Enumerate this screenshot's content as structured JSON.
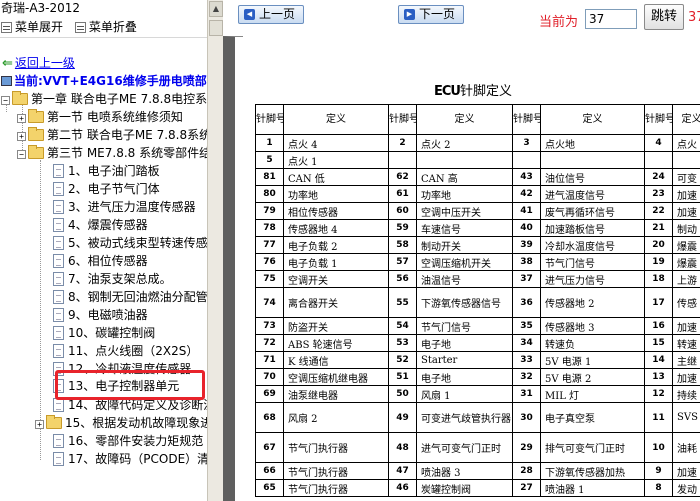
{
  "left": {
    "title": "奇瑞-A3-2012",
    "menu": {
      "expand": "菜单展开",
      "collapse": "菜单折叠"
    },
    "back_link": "返回上一级",
    "current": "当前:VVT+E4G16维修手册电喷部",
    "tree": [
      {
        "kind": "chapter",
        "label": "第一章  联合电子ME 7.8.8电控系",
        "toggle": "−"
      },
      {
        "kind": "section",
        "label": "第一节  电喷系统维修须知",
        "toggle": "+"
      },
      {
        "kind": "section",
        "label": "第二节  联合电子ME 7.8.8系统",
        "toggle": "+"
      },
      {
        "kind": "section",
        "label": "第三节  ME7.8.8 系统零部件结",
        "toggle": "−"
      },
      {
        "kind": "item",
        "label": "1、电子油门踏板"
      },
      {
        "kind": "item",
        "label": "2、电子节气门体"
      },
      {
        "kind": "item",
        "label": "3、进气压力温度传感器"
      },
      {
        "kind": "item",
        "label": "4、爆震传感器"
      },
      {
        "kind": "item",
        "label": "5、被动式线束型转速传感器"
      },
      {
        "kind": "item",
        "label": "6、相位传感器"
      },
      {
        "kind": "item",
        "label": "7、油泵支架总成。"
      },
      {
        "kind": "item",
        "label": "8、钢制无回油燃油分配管"
      },
      {
        "kind": "item",
        "label": "9、电磁喷油器"
      },
      {
        "kind": "item",
        "label": "10、碳罐控制阀"
      },
      {
        "kind": "item",
        "label": "11、点火线圈（2X2S）"
      },
      {
        "kind": "item",
        "label": "12、冷却液温度传感器"
      },
      {
        "kind": "item",
        "label": "13、电子控制器单元",
        "selected": true
      },
      {
        "kind": "item",
        "label": "14、故障代码定义及诊断流"
      },
      {
        "kind": "section",
        "label": "15、根据发动机故障现象进",
        "toggle": "+"
      },
      {
        "kind": "item",
        "label": "16、零部件安装力矩规范"
      },
      {
        "kind": "item",
        "label": "17、故障码（PCODE）清单"
      }
    ]
  },
  "viewer": {
    "prev": "上一页",
    "next": "下一页",
    "current_label": "当前为",
    "page_value": "37",
    "jump": "跳转",
    "total": "37"
  },
  "doc": {
    "title_prefix": "ECU",
    "title_suffix": "针脚定义",
    "headers": [
      "针脚号",
      "定义",
      "针脚号",
      "定义",
      "针脚号",
      "定义",
      "针脚号",
      "定义"
    ],
    "rows": [
      [
        "1",
        "点火 4",
        "2",
        "点火 2",
        "3",
        "点火地",
        "4",
        "点火"
      ],
      [
        "5",
        "点火 1",
        "",
        "",
        "",
        "",
        "",
        ""
      ],
      [
        "81",
        "CAN 低",
        "62",
        "CAN 高",
        "43",
        "油位信号",
        "24",
        "可变"
      ],
      [
        "80",
        "功率地",
        "61",
        "功率地",
        "42",
        "进气温度信号",
        "23",
        "加速"
      ],
      [
        "79",
        "相位传感器",
        "60",
        "空调中压开关",
        "41",
        "废气再循环信号",
        "22",
        "加速"
      ],
      [
        "78",
        "传感器地 4",
        "59",
        "车速信号",
        "40",
        "加速踏板信号",
        "21",
        "制动"
      ],
      [
        "77",
        "电子负载 2",
        "58",
        "制动开关",
        "39",
        "冷却水温度信号",
        "20",
        "爆震"
      ],
      [
        "76",
        "电子负载 1",
        "57",
        "空调压缩机开关",
        "38",
        "节气门信号",
        "19",
        "爆震"
      ],
      [
        "75",
        "空调开关",
        "56",
        "油温信号",
        "37",
        "进气压力信号",
        "18",
        "上游"
      ],
      [
        "74",
        "离合器开关",
        "55",
        "下游氧传感器信号",
        "36",
        "传感器地 2",
        "17",
        "传感"
      ],
      [
        "73",
        "防盗开关",
        "54",
        "节气门信号",
        "35",
        "传感器地 3",
        "16",
        "加速"
      ],
      [
        "72",
        "ABS 轮速信号",
        "53",
        "电子地",
        "34",
        "转速负",
        "15",
        "转速"
      ],
      [
        "71",
        "K 线通信",
        "52",
        "Starter",
        "33",
        "5V 电源 1",
        "14",
        "主继"
      ],
      [
        "70",
        "空调压缩机继电器",
        "51",
        "电子地",
        "32",
        "5V 电源 2",
        "13",
        "加速"
      ],
      [
        "69",
        "油泵继电器",
        "50",
        "风扇 1",
        "31",
        "MIL 灯",
        "12",
        "持续"
      ],
      [
        "68",
        "风扇 2",
        "49",
        "可变进气歧管执行器",
        "30",
        "电子真空泵",
        "11",
        "SVS"
      ],
      [
        "67",
        "节气门执行器",
        "48",
        "进气可变气门正时",
        "29",
        "排气可变气门正时",
        "10",
        "油耗"
      ],
      [
        "66",
        "节气门执行器",
        "47",
        "喷油器 3",
        "28",
        "下游氧传感器加热",
        "9",
        "加速"
      ],
      [
        "65",
        "节气门执行器",
        "46",
        "炭罐控制阀",
        "27",
        "喷油器 1",
        "8",
        "发动"
      ]
    ]
  }
}
